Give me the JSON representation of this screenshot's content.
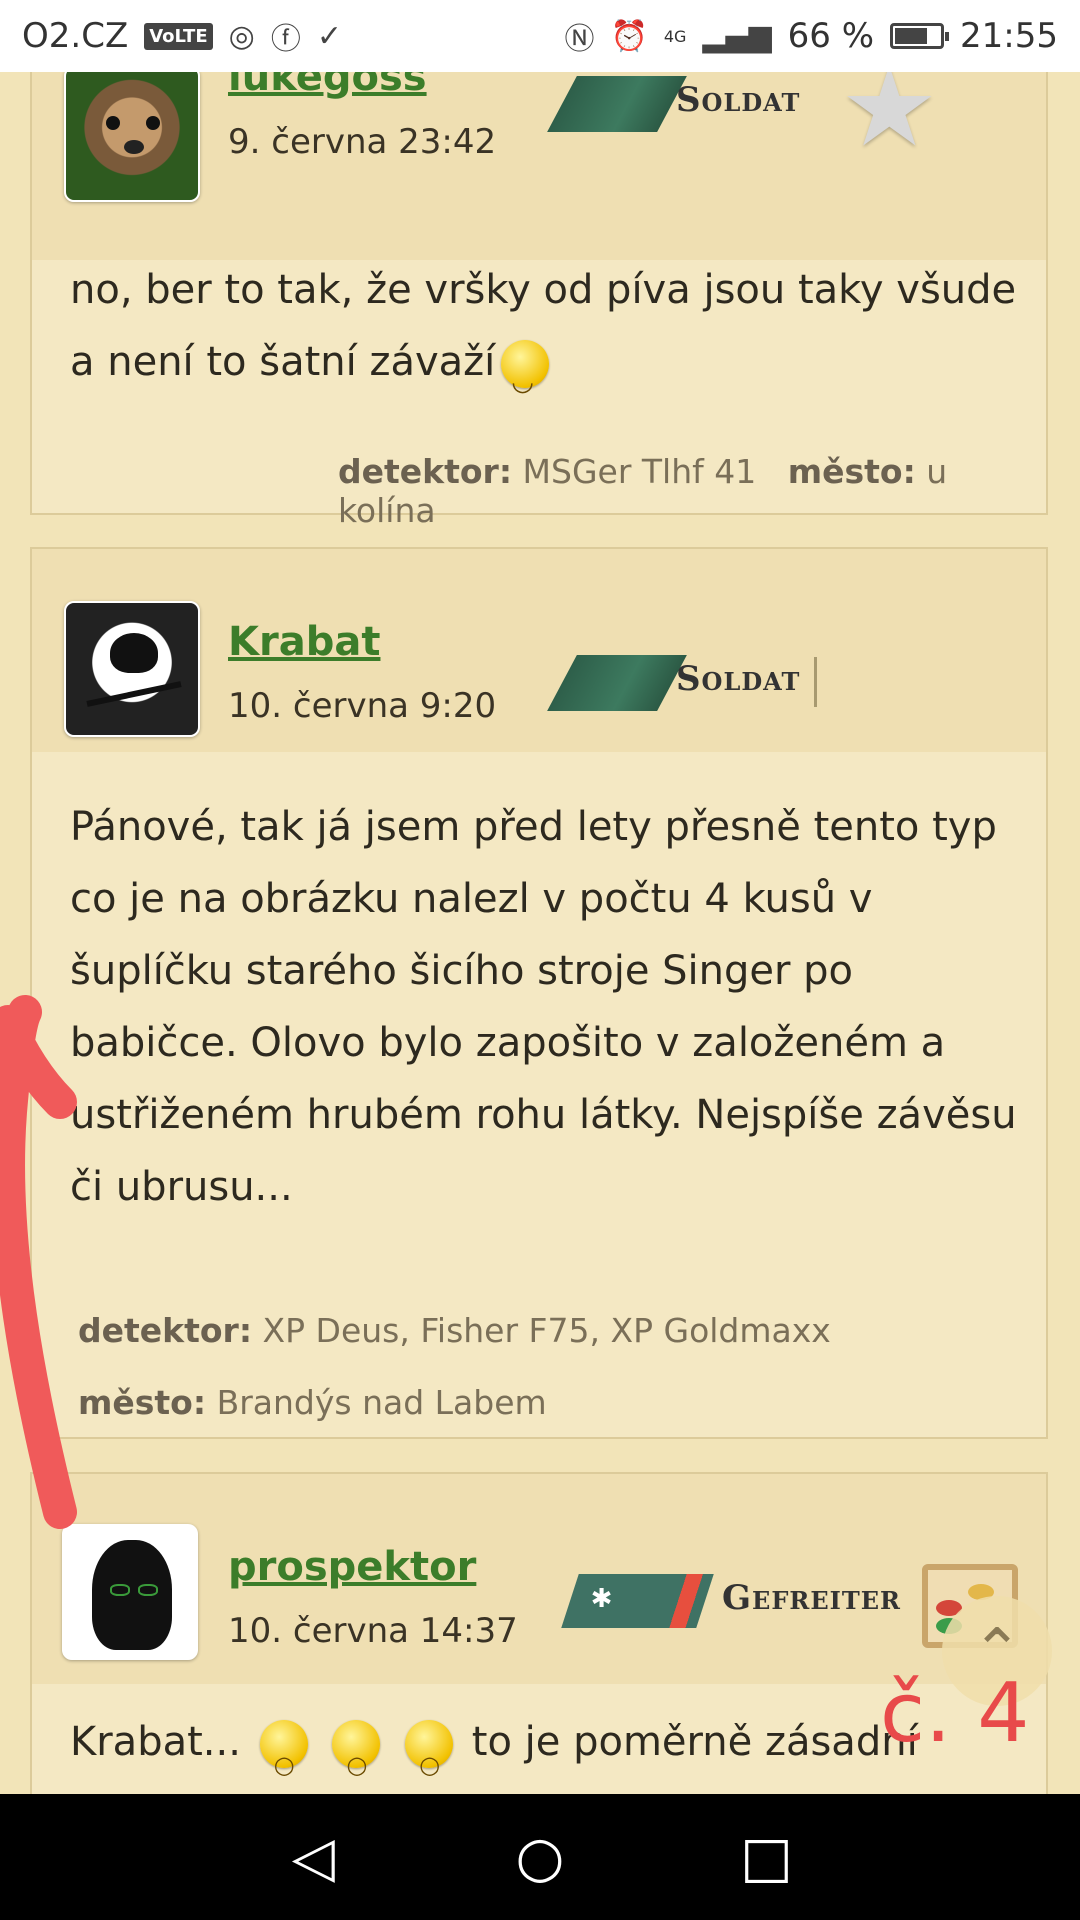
{
  "status_bar": {
    "carrier": "O2.CZ",
    "volte": "VoLTE",
    "signal_type": "4G",
    "battery": "66 %",
    "time": "21:55"
  },
  "posts": [
    {
      "username": "lukegoss",
      "date": "9. června 23:42",
      "rank": "Soldat",
      "text": "no, ber to tak, že vršky od píva jsou taky všude a není to šatní závaží",
      "detector_label": "detektor:",
      "detector_value": "MSGer Tlhf 41",
      "city_label": "město:",
      "city_value": "u kolína"
    },
    {
      "username": "Krabat",
      "date": "10. června 9:20",
      "rank": "Soldat",
      "text": "Pánové, tak já jsem před lety přesně tento typ co je na obrázku nalezl v počtu 4 kusů v šuplíčku starého šicího stroje Singer po babičce. Olovo bylo zapošito v založeném a ustřiženém hrubém rohu látky. Nejspíše závěsu či ubrusu...",
      "detector_label": "detektor:",
      "detector_value": "XP Deus, Fisher F75, XP Goldmaxx",
      "city_label": "město:",
      "city_value": "Brandýs nad Labem"
    },
    {
      "username": "prospektor",
      "date": "10. června 14:37",
      "rank": "Gefreiter",
      "text_start": "Krabat...",
      "text_end": "to je poměrně zásadní"
    }
  ],
  "annotation": "č. 4",
  "icons": {
    "scroll_top": "chevron-up-icon",
    "nav_back": "back-triangle-icon",
    "nav_home": "home-circle-icon",
    "nav_recents": "recents-square-icon"
  },
  "colors": {
    "username": "#3c7d2a",
    "annotation": "#e84a4a",
    "background": "#f2e4b8"
  }
}
